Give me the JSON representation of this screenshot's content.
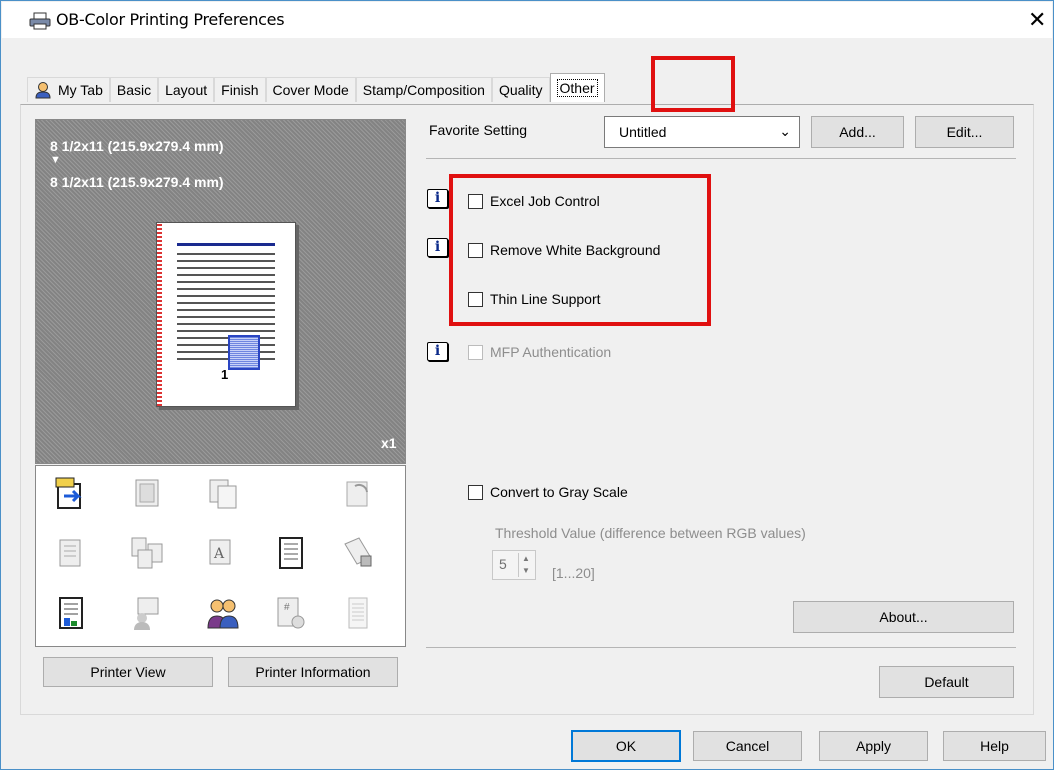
{
  "window": {
    "title": "OB-Color Printing Preferences",
    "close_symbol": "✕",
    "printer_icon": "printer-icon"
  },
  "tabs": [
    "My Tab",
    "Basic",
    "Layout",
    "Finish",
    "Cover Mode",
    "Stamp/Composition",
    "Quality",
    "Other"
  ],
  "active_tab": "Other",
  "preview": {
    "original_size": "8 1/2x11 (215.9x279.4 mm)",
    "arrow": "▼",
    "output_size": "8 1/2x11 (215.9x279.4 mm)",
    "copies": "x1",
    "page_number": "1"
  },
  "left_buttons": {
    "printer_view": "Printer View",
    "printer_information": "Printer Information"
  },
  "favorite": {
    "label": "Favorite Setting",
    "value": "Untitled",
    "add": "Add...",
    "edit": "Edit..."
  },
  "options": {
    "info_symbol": "i",
    "excel_job_control": {
      "label": "Excel Job Control",
      "checked": false
    },
    "remove_white_background": {
      "label": "Remove White Background",
      "checked": false
    },
    "thin_line_support": {
      "label": "Thin Line Support",
      "checked": false
    },
    "mfp_authentication": {
      "label": "MFP Authentication",
      "checked": false,
      "enabled": false
    },
    "convert_gray_scale": {
      "label": "Convert to Gray Scale",
      "checked": false
    },
    "threshold_label": "Threshold Value (difference between RGB values)",
    "threshold_value": "5",
    "threshold_range": "[1...20]"
  },
  "buttons": {
    "about": "About...",
    "default": "Default",
    "ok": "OK",
    "cancel": "Cancel",
    "apply": "Apply",
    "help": "Help"
  },
  "colors": {
    "highlight": "#e01010",
    "accent": "#0078d7"
  }
}
